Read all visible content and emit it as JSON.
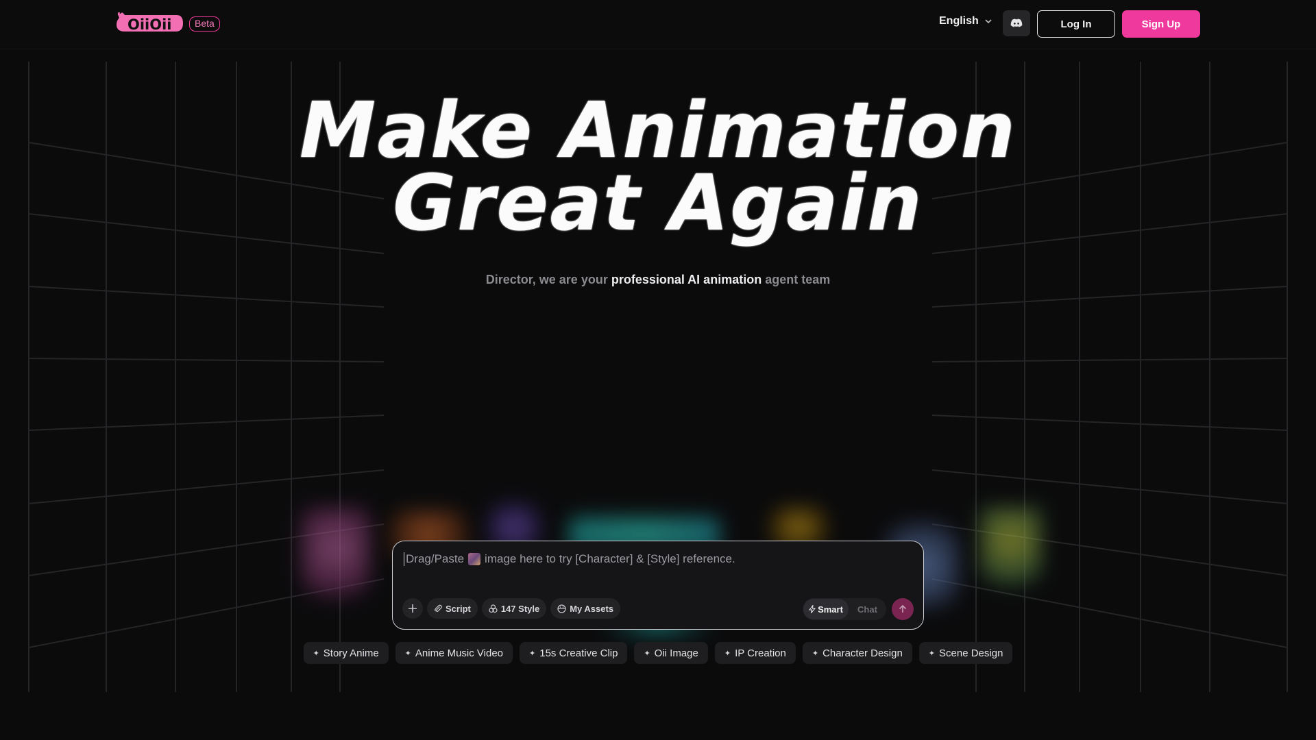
{
  "header": {
    "logo_text": "OiiOii",
    "beta_label": "Beta",
    "language": "English",
    "discord_icon": "discord-icon",
    "login_label": "Log In",
    "signup_label": "Sign Up"
  },
  "hero": {
    "title_line1": "Make Animation",
    "title_line2": "Great Again",
    "subtitle_part1": "Director, we are your ",
    "subtitle_strong": "professional AI animation",
    "subtitle_part2": " agent team"
  },
  "prompt": {
    "placeholder_part1": "Drag/Paste",
    "placeholder_part2": "image here to try [Character] & [Style] reference.",
    "tools": {
      "script": "Script",
      "style": "147 Style",
      "assets": "My Assets"
    },
    "mode_smart": "Smart",
    "mode_chat": "Chat"
  },
  "suggestions": [
    "Story Anime",
    "Anime Music Video",
    "15s Creative Clip",
    "Oii Image",
    "IP Creation",
    "Character Design",
    "Scene Design"
  ],
  "colors": {
    "accent": "#f0399d",
    "background": "#0b0b0c",
    "send_button": "#7a2452"
  }
}
